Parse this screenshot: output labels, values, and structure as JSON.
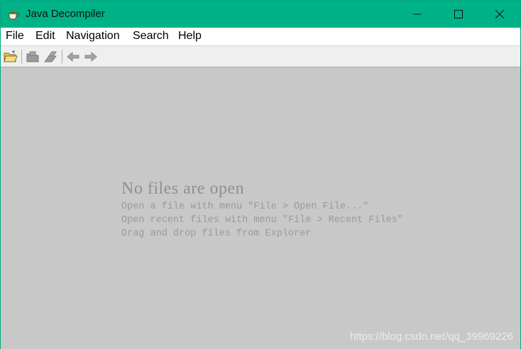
{
  "window": {
    "title": "Java Decompiler",
    "titlebar_color": "#00b287"
  },
  "menu": {
    "items": [
      "File",
      "Edit",
      "Navigation",
      "Search",
      "Help"
    ]
  },
  "toolbar": {
    "buttons": [
      {
        "icon": "open-folder-icon",
        "enabled": true
      },
      {
        "icon": "save-icon",
        "enabled": false
      },
      {
        "icon": "save-all-icon",
        "enabled": false
      },
      {
        "icon": "back-arrow-icon",
        "enabled": false
      },
      {
        "icon": "forward-arrow-icon",
        "enabled": false
      }
    ]
  },
  "welcome": {
    "heading": "No files are open",
    "hints": [
      "Open a file with menu \"File > Open File...\"",
      "Open recent files with menu \"File > Recent Files\"",
      "Drag and drop files from Explorer"
    ]
  },
  "watermark": "https://blog.csdn.net/qq_39969226"
}
